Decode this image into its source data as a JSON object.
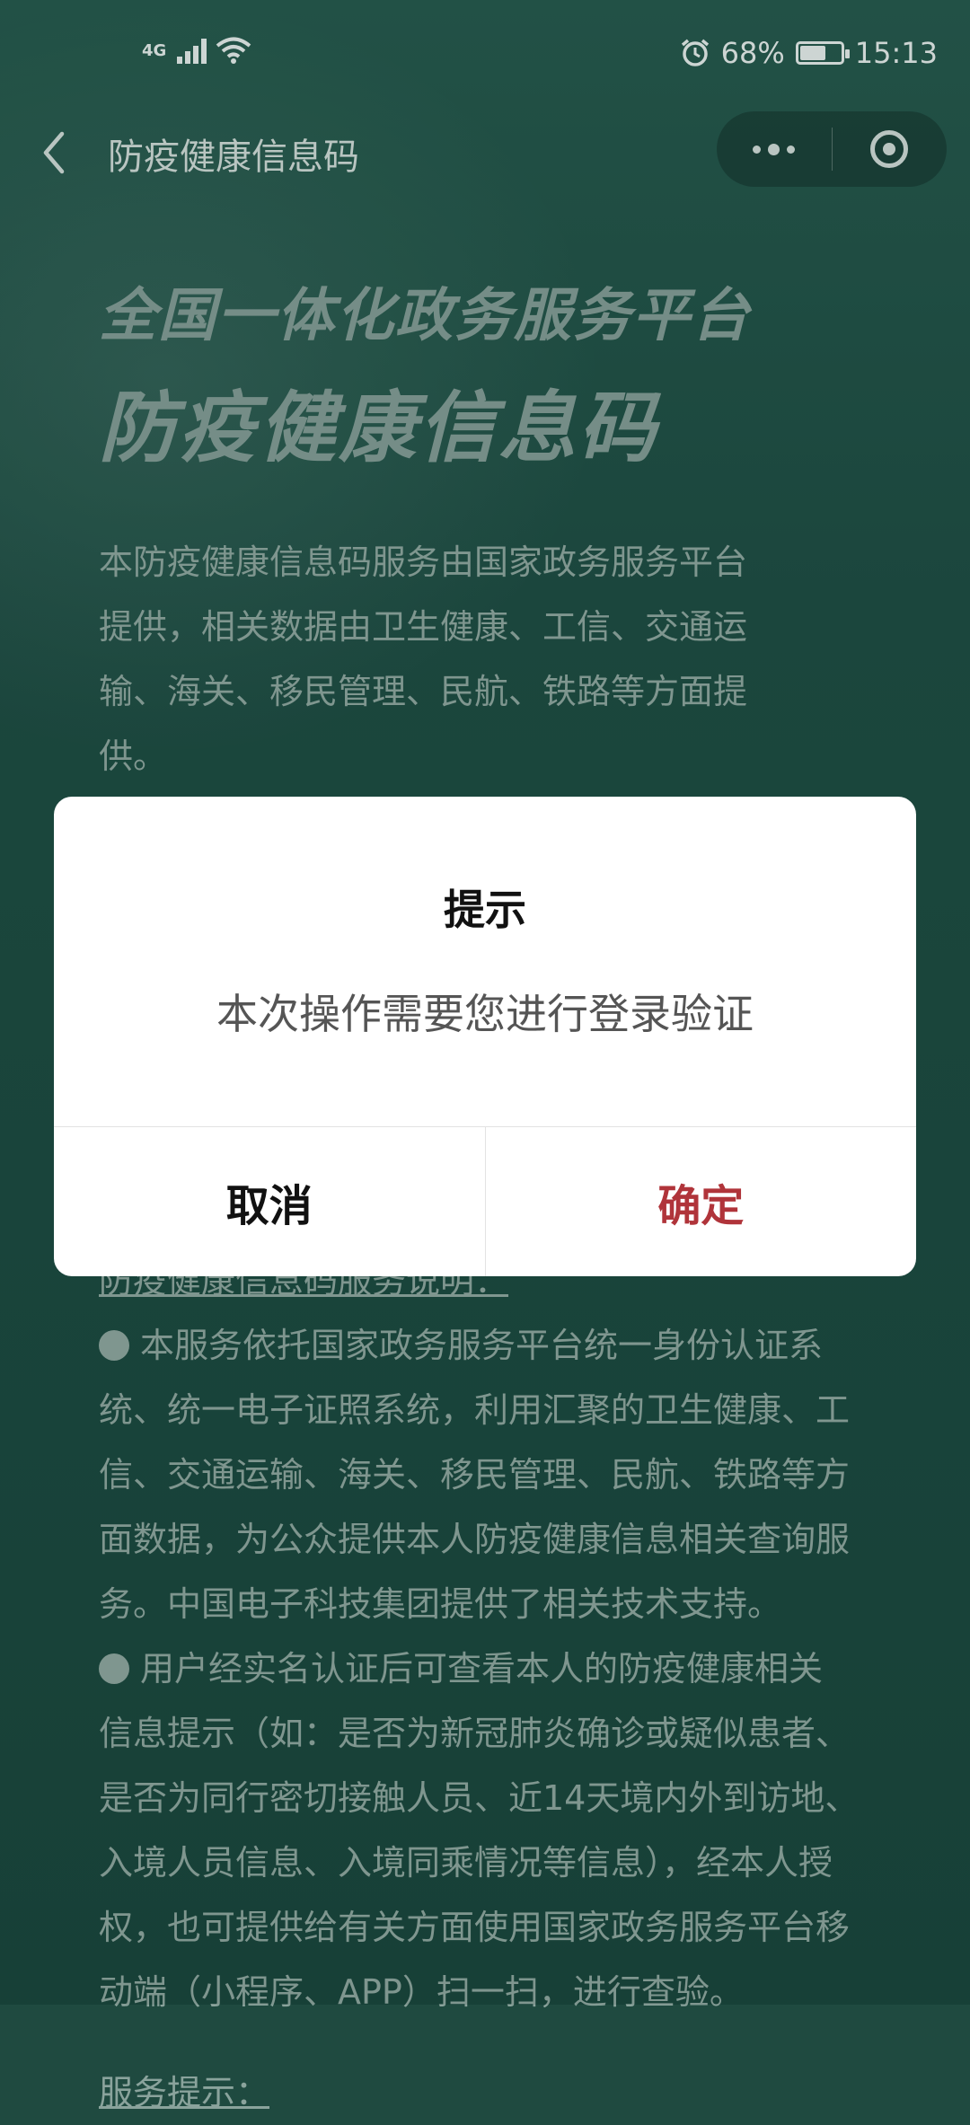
{
  "status_bar": {
    "network": "4G",
    "battery": "68%",
    "battery_level": 0.68,
    "time": "15:13"
  },
  "nav": {
    "title": "防疫健康信息码"
  },
  "hero": {
    "line1": "全国一体化政务服务平台",
    "line2": "防疫健康信息码"
  },
  "intro": {
    "lines": [
      "本防疫健康信息码服务由国家政务服务平台",
      "提供，相关数据由卫生健康、工信、交通运",
      "输、海关、移民管理、民航、铁路等方面提",
      "供。"
    ]
  },
  "service_desc": {
    "heading": "防疫健康信息码服务说明：",
    "para1_lines": [
      "本服务依托国家政务服务平台统一身份认证系",
      "统、统一电子证照系统，利用汇聚的卫生健康、工",
      "信、交通运输、海关、移民管理、民航、铁路等方",
      "面数据，为公众提供本人防疫健康信息相关查询服",
      "务。中国电子科技集团提供了相关技术支持。"
    ],
    "para2_lines": [
      "用户经实名认证后可查看本人的防疫健康相关",
      "信息提示（如：是否为新冠肺炎确诊或疑似患者、",
      "是否为同行密切接触人员、近14天境内外到访地、",
      "入境人员信息、入境同乘情况等信息），经本人授",
      "权，也可提供给有关方面使用国家政务服务平台移",
      "动端（小程序、APP）扫一扫，进行查验。"
    ]
  },
  "service_tips": {
    "heading": "服务提示："
  },
  "dialog": {
    "title": "提示",
    "message": "本次操作需要您进行登录验证",
    "cancel_label": "取消",
    "confirm_label": "确定"
  },
  "colors": {
    "background": "#1f4a40",
    "confirm": "#b0343a",
    "dialog": "#ffffff"
  },
  "icons": {
    "back": "chevron-left-icon",
    "more": "more-dots-icon",
    "close_miniprogram": "target-circle-icon",
    "alarm": "alarm-clock-icon",
    "wifi": "wifi-icon"
  }
}
